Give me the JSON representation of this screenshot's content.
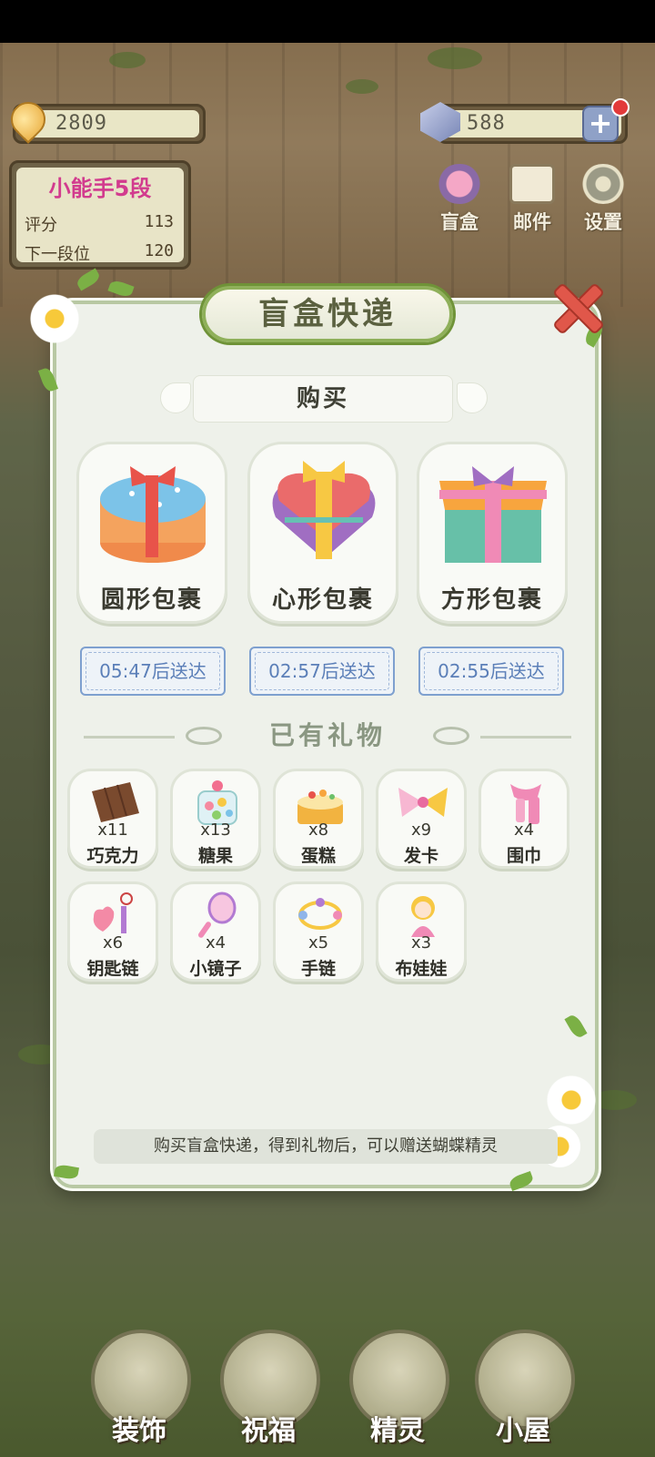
{
  "hud": {
    "coins": "2809",
    "gems": "588"
  },
  "rank": {
    "title": "小能手5段",
    "score_label": "评分",
    "score_value": "113",
    "next_label": "下一段位",
    "next_value": "120"
  },
  "top_buttons": [
    {
      "label": "盲盒",
      "icon": "flower-box-icon"
    },
    {
      "label": "邮件",
      "icon": "mail-icon"
    },
    {
      "label": "设置",
      "icon": "gear-icon"
    }
  ],
  "modal": {
    "title": "盲盒快递",
    "buy_header": "购买",
    "packages": [
      {
        "name": "圆形包裹",
        "timer": "05:47后送达"
      },
      {
        "name": "心形包裹",
        "timer": "02:57后送达"
      },
      {
        "name": "方形包裹",
        "timer": "02:55后送达"
      }
    ],
    "owned_header": "已有礼物",
    "gifts": [
      {
        "name": "巧克力",
        "count": "x11"
      },
      {
        "name": "糖果",
        "count": "x13"
      },
      {
        "name": "蛋糕",
        "count": "x8"
      },
      {
        "name": "发卡",
        "count": "x9"
      },
      {
        "name": "围巾",
        "count": "x4"
      },
      {
        "name": "钥匙链",
        "count": "x6"
      },
      {
        "name": "小镜子",
        "count": "x4"
      },
      {
        "name": "手链",
        "count": "x5"
      },
      {
        "name": "布娃娃",
        "count": "x3"
      }
    ],
    "hint": "购买盲盒快递，得到礼物后，可以赠送蝴蝶精灵"
  },
  "bottom_nav": [
    {
      "label": "装饰"
    },
    {
      "label": "祝福"
    },
    {
      "label": "精灵"
    },
    {
      "label": "小屋"
    }
  ],
  "colors": {
    "accent_green": "#8fb05a",
    "timer_blue": "#5b7fb8",
    "close_red": "#e0574a",
    "rank_pink": "#d23b8e"
  }
}
